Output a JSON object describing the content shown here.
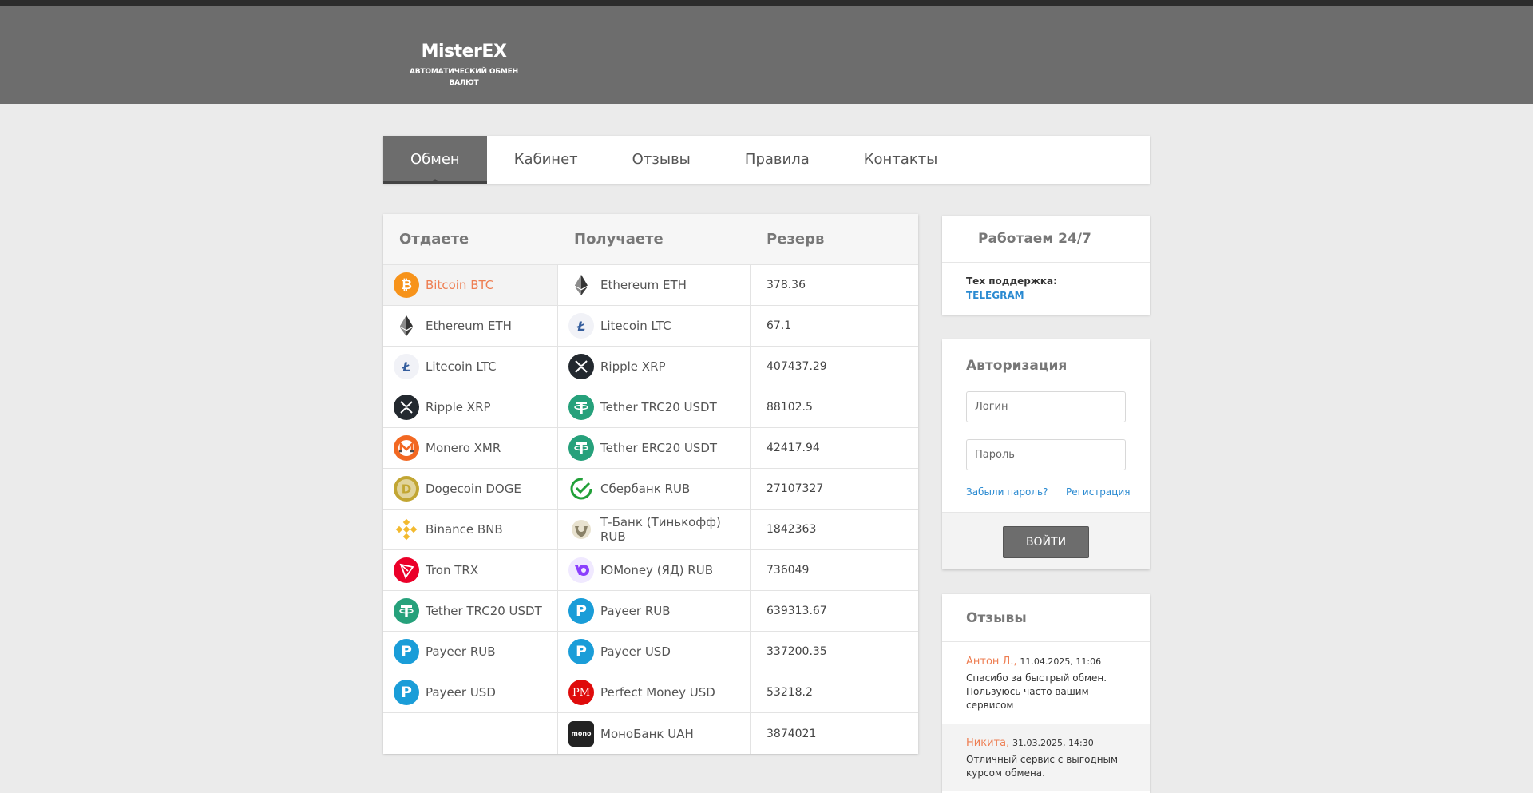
{
  "logo": {
    "title": "MisterEX",
    "subtitle": "АВТОМАТИЧЕСКИЙ ОБМЕН ВАЛЮТ"
  },
  "nav": {
    "items": [
      {
        "label": "Обмен",
        "active": true
      },
      {
        "label": "Кабинет"
      },
      {
        "label": "Отзывы"
      },
      {
        "label": "Правила"
      },
      {
        "label": "Контакты"
      }
    ]
  },
  "exchange": {
    "headers": {
      "give": "Отдаете",
      "receive": "Получаете",
      "reserve": "Резерв"
    },
    "give": [
      {
        "label": "Bitcoin BTC",
        "icon": "btc"
      },
      {
        "label": "Ethereum ETH",
        "icon": "eth"
      },
      {
        "label": "Litecoin LTC",
        "icon": "ltc"
      },
      {
        "label": "Ripple XRP",
        "icon": "xrp"
      },
      {
        "label": "Monero XMR",
        "icon": "xmr"
      },
      {
        "label": "Dogecoin DOGE",
        "icon": "doge"
      },
      {
        "label": "Binance BNB",
        "icon": "bnb"
      },
      {
        "label": "Tron TRX",
        "icon": "trx"
      },
      {
        "label": "Tether TRC20 USDT",
        "icon": "usdt"
      },
      {
        "label": "Payeer RUB",
        "icon": "payeer"
      },
      {
        "label": "Payeer USD",
        "icon": "payeer"
      }
    ],
    "receive": [
      {
        "label": "Ethereum ETH",
        "icon": "eth",
        "reserve": "378.36"
      },
      {
        "label": "Litecoin LTC",
        "icon": "ltc",
        "reserve": "67.1"
      },
      {
        "label": "Ripple XRP",
        "icon": "xrp",
        "reserve": "407437.29"
      },
      {
        "label": "Tether TRC20 USDT",
        "icon": "usdt",
        "reserve": "88102.5"
      },
      {
        "label": "Tether ERC20 USDT",
        "icon": "usdt",
        "reserve": "42417.94"
      },
      {
        "label": "Сбербанк RUB",
        "icon": "sber",
        "reserve": "27107327"
      },
      {
        "label": "Т-Банк (Тинькофф) RUB",
        "icon": "tbank",
        "reserve": "1842363"
      },
      {
        "label": "ЮMoney (ЯД) RUB",
        "icon": "yoomoney",
        "reserve": "736049"
      },
      {
        "label": "Payeer RUB",
        "icon": "payeer",
        "reserve": "639313.67"
      },
      {
        "label": "Payeer USD",
        "icon": "payeer",
        "reserve": "337200.35"
      },
      {
        "label": "Perfect Money USD",
        "icon": "pm",
        "reserve": "53218.2"
      },
      {
        "label": "МоноБанк UAH",
        "icon": "mono",
        "reserve": "3874021"
      }
    ]
  },
  "work": {
    "title": "Работаем 24/7",
    "support_label": "Тех поддержка:",
    "support_link": "TELEGRAM"
  },
  "auth": {
    "title": "Авторизация",
    "login_placeholder": "Логин",
    "password_placeholder": "Пароль",
    "forgot": "Забыли пароль?",
    "register": "Регистрация",
    "submit": "ВОЙТИ"
  },
  "reviews": {
    "title": "Отзывы",
    "items": [
      {
        "name": "Антон Л.,",
        "date": "11.04.2025, 11:06",
        "text": "Спасибо за быстрый обмен. Пользуюсь часто вашим сервисом"
      },
      {
        "name": "Никита,",
        "date": "31.03.2025, 14:30",
        "text": "Отличный сервис с выгодным курсом обмена."
      }
    ]
  },
  "icon_colors": {
    "btc": "#f7931a",
    "xmr": "#f26822",
    "doge": "#c2a633",
    "bnb": "#f3ba2f",
    "trx": "#eb0029",
    "usdt": "#26a17b",
    "payeer": "#1a9dd8",
    "xrp": "#23292f",
    "pm": "#df0b0b",
    "mono": "#222222",
    "yoomoney": "#8b3ffd",
    "sber": "#21a038"
  }
}
